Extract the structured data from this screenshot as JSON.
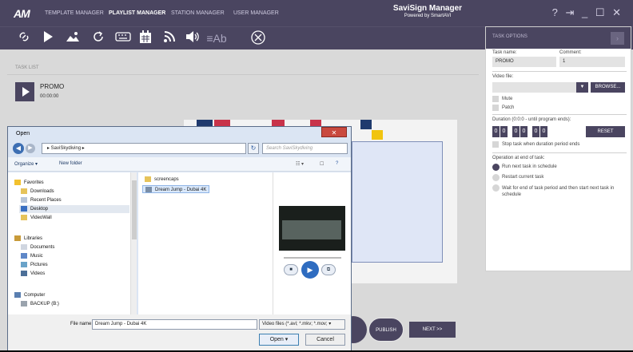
{
  "app": {
    "logo": "AM",
    "title": "SaviSign Manager",
    "subtitle": "Powered by SmartAVI"
  },
  "nav_tabs": [
    "TEMPLATE MANAGER",
    "PLAYLIST MANAGER",
    "STATION MANAGER",
    "USER MANAGER"
  ],
  "active_tab": "PLAYLIST MANAGER",
  "window_controls": "? ⇥ _ ☐ ✕",
  "toolbar_icons": [
    "link-icon",
    "play-icon",
    "image-icon",
    "refresh-icon",
    "keyboard-icon",
    "calendar-icon",
    "rss-icon",
    "volume-icon",
    "text-icon",
    "cancel-icon"
  ],
  "toolbar": {
    "text_tool": "Ab"
  },
  "tasklist": {
    "label": "TASK LIST",
    "task_name": "PROMO",
    "task_time": "00:00:00"
  },
  "buttons": {
    "publish": "PUBLISH",
    "next": "NEXT >>"
  },
  "task_options": {
    "title": "TASK OPTIONS",
    "task_name_label": "Task name:",
    "task_name": "PROMO",
    "comment_label": "Comment:",
    "comment": "1",
    "video_file_label": "Video file:",
    "video_file": "",
    "browse": "BROWSE...",
    "mute": "Mute",
    "patch": "Patch",
    "duration_label": "Duration (0:0:0 - until program ends):",
    "duration_digits": [
      "0",
      "0",
      "0",
      "0",
      "0",
      "0"
    ],
    "reset": "RESET",
    "stop_task": "Stop task when duration period ends",
    "end_label": "Operation at end of task:",
    "end_options": [
      "Run next task in schedule",
      "Restart current task",
      "Wait for end of task period and then start next task in schedule"
    ],
    "end_selected": 0
  },
  "dialog": {
    "title": "Open",
    "path": "▸ SaviSkydiving ▸",
    "search_placeholder": "Search SaviSkydiving",
    "organize": "Organize ▾",
    "new_folder": "New folder",
    "favorites": "Favorites",
    "nav_favorites": [
      "Downloads",
      "Recent Places",
      "Desktop",
      "VideoWall"
    ],
    "libraries": "Libraries",
    "nav_libraries": [
      "Documents",
      "Music",
      "Pictures",
      "Videos"
    ],
    "computer": "Computer",
    "nav_computer": [
      "BACKUP (B:)"
    ],
    "files": [
      "screencaps",
      "Dream Jump - Dubai 4K"
    ],
    "selected_file": "Dream Jump - Dubai 4K",
    "file_name_label": "File name:",
    "file_name": "Dream Jump - Dubai 4K",
    "file_type": "Video files (*.avi; *.mkv; *.mov; ▾",
    "open": "Open",
    "cancel": "Cancel"
  }
}
